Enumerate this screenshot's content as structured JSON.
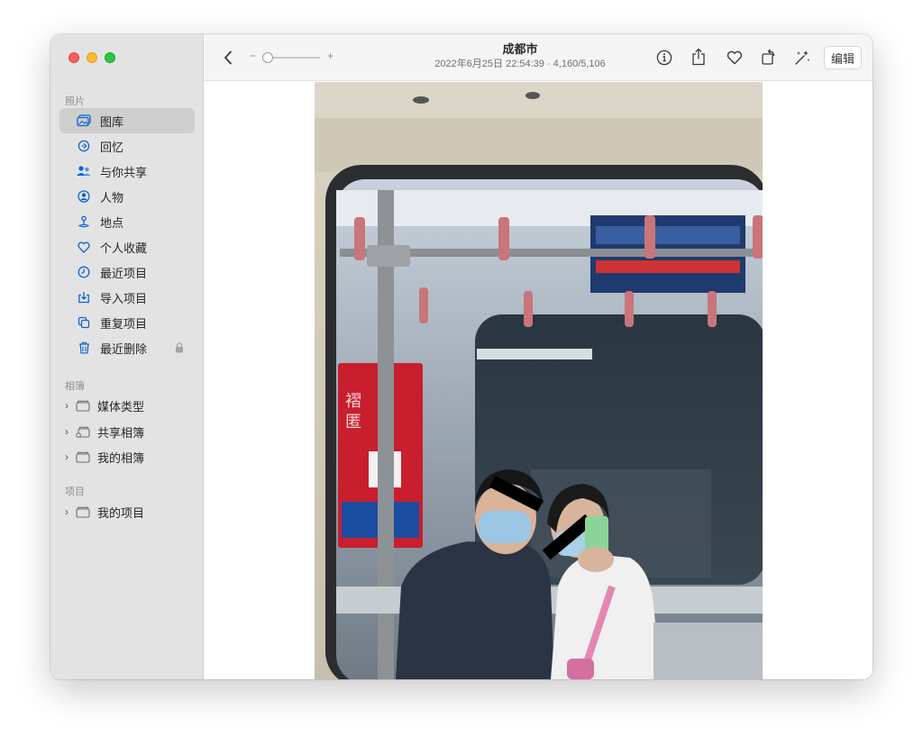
{
  "window": {
    "title": "成都市",
    "subtitle": "2022年6月25日 22:54:39 · 4,160/5,106"
  },
  "toolbar": {
    "back_icon": "chevron-left-icon",
    "zoom_minus": "−",
    "zoom_plus": "+",
    "zoom_level": 0,
    "edit_label": "编辑",
    "icons": [
      "info-icon",
      "share-icon",
      "heart-icon",
      "rotate-icon",
      "magic-wand-icon"
    ]
  },
  "sidebar": {
    "sections": {
      "photos": "照片",
      "albums": "相簿",
      "projects": "项目"
    },
    "items": [
      {
        "label": "图库",
        "icon": "library-icon",
        "selected": true
      },
      {
        "label": "回忆",
        "icon": "memories-icon"
      },
      {
        "label": "与你共享",
        "icon": "shared-with-you-icon"
      },
      {
        "label": "人物",
        "icon": "people-icon"
      },
      {
        "label": "地点",
        "icon": "places-icon"
      },
      {
        "label": "个人收藏",
        "icon": "heart-icon"
      },
      {
        "label": "最近项目",
        "icon": "clock-icon"
      },
      {
        "label": "导入项目",
        "icon": "import-icon"
      },
      {
        "label": "重复项目",
        "icon": "duplicates-icon"
      },
      {
        "label": "最近删除",
        "icon": "trash-icon",
        "locked": true
      }
    ],
    "albums": [
      {
        "label": "媒体类型",
        "icon": "folder-icon"
      },
      {
        "label": "共享相簿",
        "icon": "shared-folder-icon"
      },
      {
        "label": "我的相簿",
        "icon": "folder-icon"
      }
    ],
    "projects": [
      {
        "label": "我的项目",
        "icon": "folder-icon"
      }
    ]
  },
  "colors": {
    "accent": "#0a64d6",
    "sidebar_bg": "#e4e3e4",
    "selected_bg": "#cfcecf"
  }
}
